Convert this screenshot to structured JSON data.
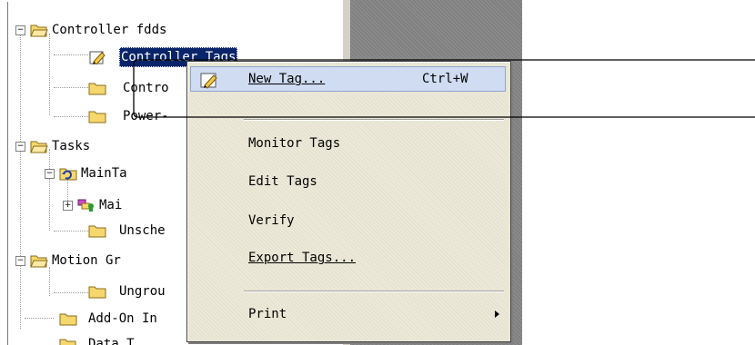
{
  "tree": {
    "items": [
      {
        "label": "Controller fdds",
        "icon": "folder-open-icon",
        "expander": "−"
      },
      {
        "label": "Controller Tags",
        "icon": "pencil-tag-icon",
        "selected": true
      },
      {
        "label": "Contro",
        "icon": "folder-icon"
      },
      {
        "label": "Power-",
        "icon": "folder-icon"
      },
      {
        "label": "Tasks",
        "icon": "folder-open-icon",
        "expander": "−"
      },
      {
        "label": "MainTa",
        "icon": "task-icon",
        "expander": "−"
      },
      {
        "label": "Mai",
        "icon": "program-icon",
        "expander": "+"
      },
      {
        "label": "Unsche",
        "icon": "folder-icon"
      },
      {
        "label": "Motion Gr",
        "icon": "folder-open-icon",
        "expander": "−"
      },
      {
        "label": "Ungrou",
        "icon": "folder-icon"
      },
      {
        "label": "Add-On In",
        "icon": "folder-icon"
      },
      {
        "label": "Data T",
        "icon": "folder-open-icon"
      }
    ]
  },
  "context_menu": {
    "new_tag": {
      "label": "New Tag...",
      "mnemonic": "N",
      "shortcut": "Ctrl+W",
      "icon": "pencil-tag-icon"
    },
    "monitor_tags": {
      "label": "Monitor Tags"
    },
    "edit_tags": {
      "label": "Edit Tags"
    },
    "verify": {
      "label": "Verify"
    },
    "export_tags": {
      "label": "Export Tags...",
      "mnemonic": "E"
    },
    "print": {
      "label": "Print"
    }
  },
  "colors": {
    "selection": "#0a246a",
    "menu_highlight": "#cfdcf2",
    "folder": "#f5d76e"
  }
}
